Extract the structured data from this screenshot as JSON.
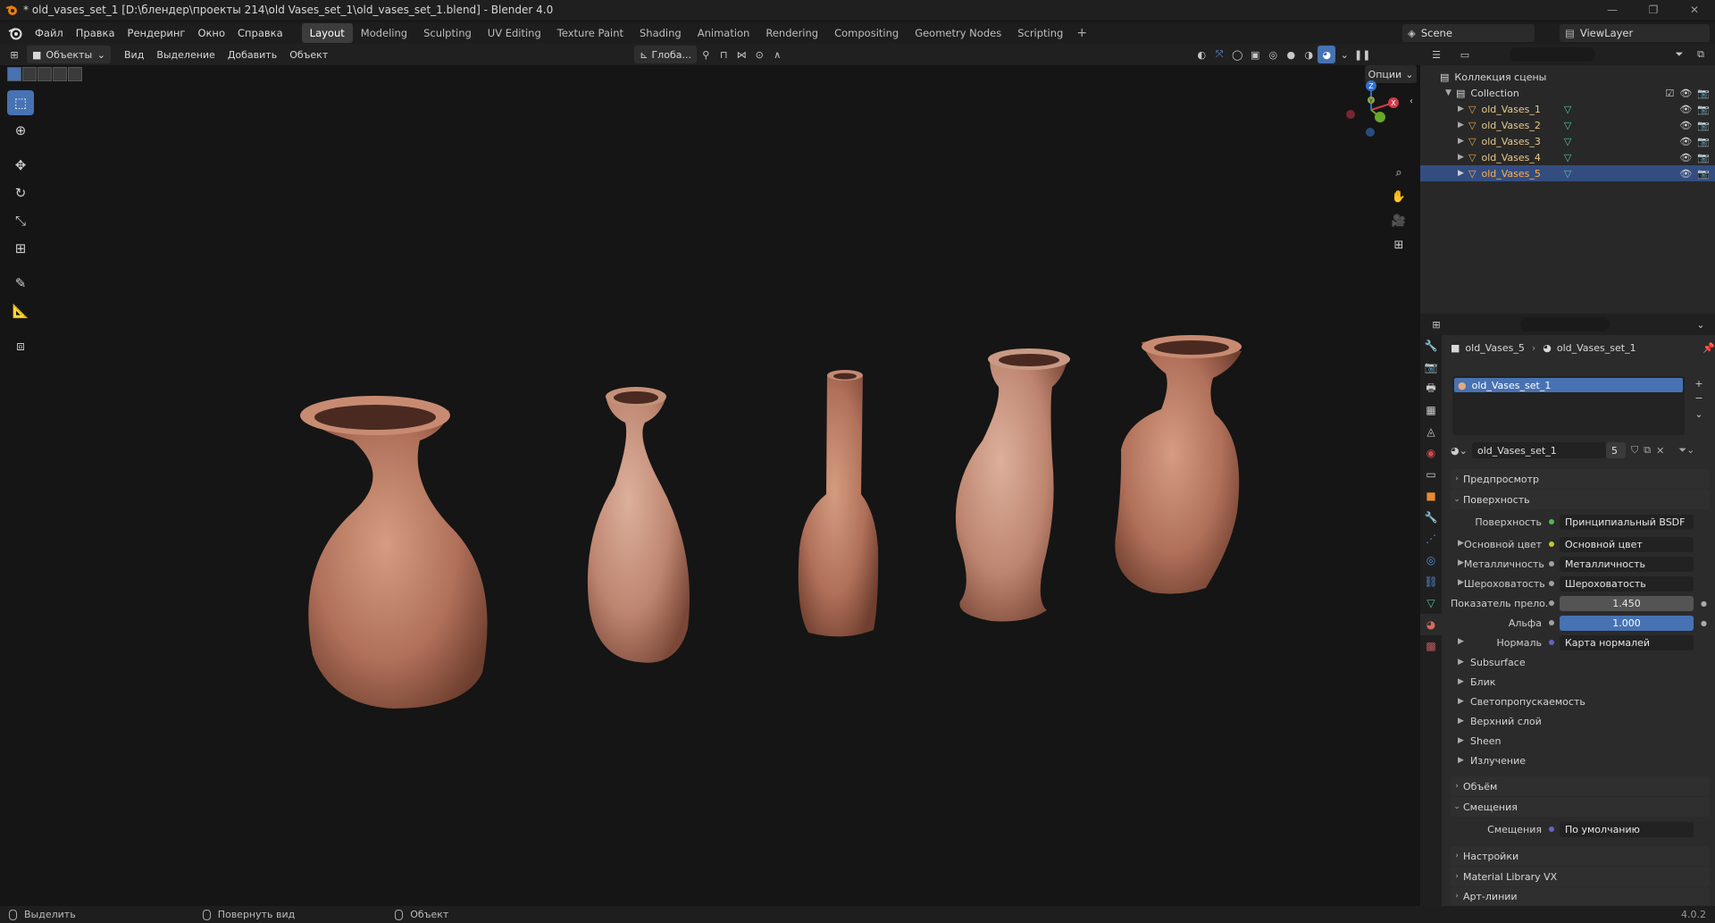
{
  "window": {
    "title": "* old_vases_set_1 [D:\\блендер\\проекты 214\\old Vases_set_1\\old_vases_set_1.blend] - Blender 4.0"
  },
  "menus": [
    "Файл",
    "Правка",
    "Рендеринг",
    "Окно",
    "Справка"
  ],
  "workspaces": [
    {
      "label": "Layout",
      "active": true
    },
    {
      "label": "Modeling"
    },
    {
      "label": "Sculpting"
    },
    {
      "label": "UV Editing"
    },
    {
      "label": "Texture Paint"
    },
    {
      "label": "Shading"
    },
    {
      "label": "Animation"
    },
    {
      "label": "Rendering"
    },
    {
      "label": "Compositing"
    },
    {
      "label": "Geometry Nodes"
    },
    {
      "label": "Scripting"
    }
  ],
  "scene": {
    "name": "Scene",
    "view_layer": "ViewLayer"
  },
  "viewport_header": {
    "mode": "Объекты",
    "menus": [
      "Вид",
      "Выделение",
      "Добавить",
      "Объект"
    ],
    "orientation": "Глоба...",
    "options": "Опции"
  },
  "outliner": {
    "root": "Коллекция сцены",
    "collection": "Collection",
    "objects": [
      {
        "name": "old_Vases_1",
        "selected": false
      },
      {
        "name": "old_Vases_2",
        "selected": false
      },
      {
        "name": "old_Vases_3",
        "selected": false
      },
      {
        "name": "old_Vases_4",
        "selected": false
      },
      {
        "name": "old_Vases_5",
        "selected": true
      }
    ]
  },
  "properties": {
    "breadcrumb_object": "old_Vases_5",
    "breadcrumb_material": "old_Vases_set_1",
    "slot": "old_Vases_set_1",
    "material_name": "old_Vases_set_1",
    "user_count": "5",
    "panels": {
      "preview": "Предпросмотр",
      "surface": "Поверхность",
      "volume": "Объём",
      "displacement": "Смещения",
      "settings": "Настройки",
      "material_library": "Material Library VX",
      "lineart": "Арт-линии"
    },
    "surface_rows": [
      {
        "label": "Поверхность",
        "value": "Принципиальный BSDF",
        "dot": "#56b556",
        "style": "dark",
        "arrow": false
      },
      {
        "label": "Основной цвет",
        "value": "Основной цвет",
        "dot": "#c7c729",
        "style": "dark",
        "arrow": true
      },
      {
        "label": "Металличность",
        "value": "Металличность",
        "dot": "#a1a1a1",
        "style": "dark",
        "arrow": true
      },
      {
        "label": "Шероховатость",
        "value": "Шероховатость",
        "dot": "#a1a1a1",
        "style": "dark",
        "arrow": true
      },
      {
        "label": "Показатель прело...",
        "value": "1.450",
        "dot": "#a1a1a1",
        "style": "num",
        "arrow": false
      },
      {
        "label": "Альфа",
        "value": "1.000",
        "dot": "#a1a1a1",
        "style": "blue",
        "arrow": false
      },
      {
        "label": "Нормаль",
        "value": "Карта нормалей",
        "dot": "#6363c7",
        "style": "dark",
        "arrow": true
      }
    ],
    "subpanels": [
      "Subsurface",
      "Блик",
      "Светопропускаемость",
      "Верхний слой",
      "Sheen",
      "Излучение"
    ],
    "displacement_row": {
      "label": "Смещения",
      "value": "По умолчанию",
      "dot": "#6363c7"
    }
  },
  "statusbar": {
    "select": "Выделить",
    "rotate": "Повернуть вид",
    "object": "Объект",
    "version": "4.0.2"
  },
  "colors": {
    "accent": "#4772b3",
    "selected_row": "#334d80",
    "vase": "#b97a5c"
  }
}
